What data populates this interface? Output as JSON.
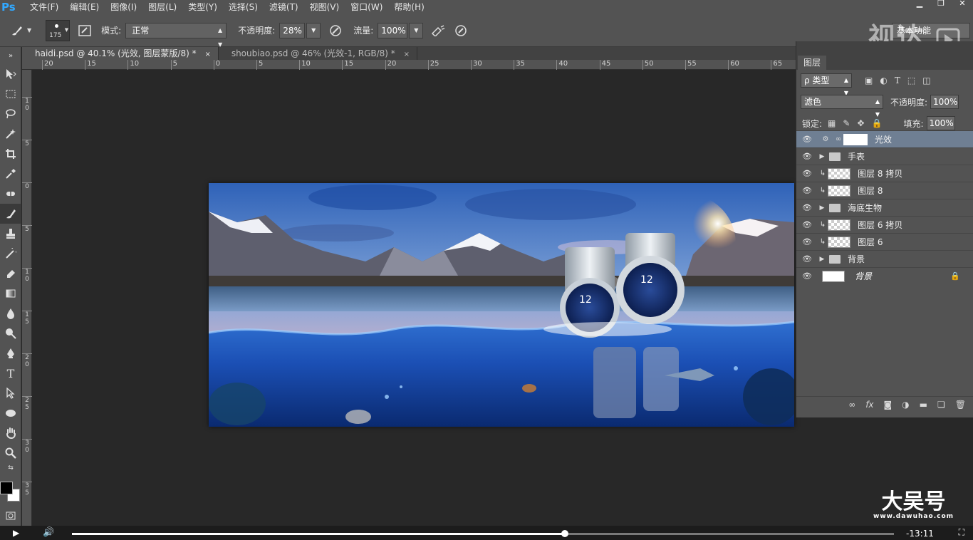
{
  "app": {
    "logo": "Ps"
  },
  "menu": [
    "文件(F)",
    "编辑(E)",
    "图像(I)",
    "图层(L)",
    "类型(Y)",
    "选择(S)",
    "滤镜(T)",
    "视图(V)",
    "窗口(W)",
    "帮助(H)"
  ],
  "window_controls": {
    "minimize": "▁",
    "restore": "❐",
    "close": "✕"
  },
  "options": {
    "brush_size": "175",
    "mode_label": "模式:",
    "mode_value": "正常",
    "opacity_label": "不透明度:",
    "opacity_value": "28%",
    "flow_label": "流量:",
    "flow_value": "100%",
    "workspace": "基本功能"
  },
  "watermark_top": "视达",
  "tabs": [
    {
      "label": "haidi.psd @ 40.1% (光效, 图层蒙版/8) *",
      "close": "×"
    },
    {
      "label": "shoubiao.psd @ 46% (光效-1, RGB/8) *",
      "close": "×"
    }
  ],
  "ruler_h": [
    "20",
    "15",
    "10",
    "5",
    "0",
    "5",
    "10",
    "15",
    "20",
    "25",
    "30",
    "35",
    "40",
    "45",
    "50",
    "55",
    "60",
    "65"
  ],
  "ruler_v": [
    "1 0",
    "5",
    "0",
    "5",
    "1 0",
    "1 5",
    "2 0",
    "2 5",
    "3 0",
    "3 5"
  ],
  "layers_panel": {
    "title": "图层",
    "filter_label": "ρ 类型",
    "blend_mode": "滤色",
    "opacity_label": "不透明度:",
    "opacity_value": "100%",
    "lock_label": "锁定:",
    "fill_label": "填充:",
    "fill_value": "100%",
    "layers": [
      {
        "name": "光效",
        "type": "mask",
        "selected": true
      },
      {
        "name": "手表",
        "type": "group"
      },
      {
        "name": "图层 8 拷贝",
        "type": "clip"
      },
      {
        "name": "图层 8",
        "type": "clip"
      },
      {
        "name": "海底生物",
        "type": "group"
      },
      {
        "name": "图层 6 拷贝",
        "type": "clip"
      },
      {
        "name": "图层 6",
        "type": "clip"
      },
      {
        "name": "背景",
        "type": "group"
      },
      {
        "name": "背景",
        "type": "background"
      }
    ]
  },
  "video": {
    "progress": 0.6,
    "time_remaining": "-13:11"
  },
  "watermark_bottom": {
    "title": "大吴号",
    "url": "www.dawuhao.com"
  },
  "colors": {
    "accent": "#31a8ff",
    "selected_layer": "#6f7f93",
    "panel": "#535353"
  }
}
